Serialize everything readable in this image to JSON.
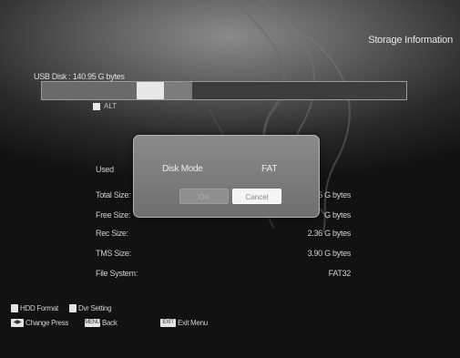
{
  "screen": {
    "title": "Storage Information"
  },
  "device": {
    "label": "USB Disk : 140.95 G bytes"
  },
  "usage_legend": {
    "label": "ALT"
  },
  "info": [
    {
      "key": "Used",
      "value": ""
    },
    {
      "key": "Total Size:",
      "value": "5 G bytes"
    },
    {
      "key": "Free Size:",
      "value": "G bytes"
    },
    {
      "key": "Rec Size:",
      "value": "2.36 G bytes"
    },
    {
      "key": "TMS Size:",
      "value": "3.90 G bytes"
    },
    {
      "key": "File System:",
      "value": "FAT32"
    }
  ],
  "dialog": {
    "label": "Disk Mode",
    "value": "FAT",
    "ok_label": "OK",
    "cancel_label": "Cancel"
  },
  "hints": {
    "hdd_format": "HDD Format",
    "dvr_setting": "Dvr Setting",
    "change_press": "Change Press",
    "back": "Back",
    "exit_menu": "Exit Menu",
    "back_key": "MENU",
    "exit_key": "EXIT"
  }
}
